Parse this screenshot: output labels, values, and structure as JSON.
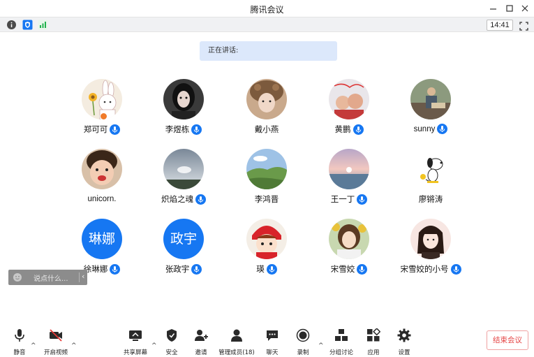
{
  "window": {
    "title": "腾讯会议"
  },
  "status": {
    "time": "14:41"
  },
  "speaking": {
    "label": "正在讲话:"
  },
  "participants": [
    {
      "name": "郑可可",
      "mic": true,
      "avatar": "bunny-icon"
    },
    {
      "name": "李煜栋",
      "mic": true,
      "avatar": "photo"
    },
    {
      "name": "戴小燕",
      "mic": false,
      "avatar": "photo"
    },
    {
      "name": "黄鹏",
      "mic": true,
      "avatar": "photo"
    },
    {
      "name": "sunny",
      "mic": true,
      "avatar": "photo"
    },
    {
      "name": "unicorn.",
      "mic": false,
      "avatar": "photo"
    },
    {
      "name": "炽焰之魂",
      "mic": true,
      "avatar": "photo"
    },
    {
      "name": "李鸿晋",
      "mic": false,
      "avatar": "photo"
    },
    {
      "name": "王一丁",
      "mic": true,
      "avatar": "photo"
    },
    {
      "name": "廖锵涛",
      "mic": false,
      "avatar": "snoopy-icon"
    },
    {
      "name": "徐琳娜",
      "mic": true,
      "avatar_text": "琳娜"
    },
    {
      "name": "张政宇",
      "mic": true,
      "avatar_text": "政宇"
    },
    {
      "name": "瑛",
      "mic": true,
      "avatar": "cartoon"
    },
    {
      "name": "宋雪姣",
      "mic": true,
      "avatar": "illustration"
    },
    {
      "name": "宋雪姣的小号",
      "mic": true,
      "avatar": "illustration"
    }
  ],
  "chat": {
    "placeholder": "说点什么..."
  },
  "toolbar": {
    "mute": "静音",
    "video": "开启视频",
    "share": "共享屏幕",
    "security": "安全",
    "invite": "邀请",
    "members": "管理成员(18)",
    "chat": "聊天",
    "record": "录制",
    "breakout": "分组讨论",
    "apps": "应用",
    "settings": "设置",
    "end": "结束会议"
  },
  "colors": {
    "accent": "#1677f2",
    "end": "#e54545",
    "speaking_bg": "#dce8fb"
  }
}
